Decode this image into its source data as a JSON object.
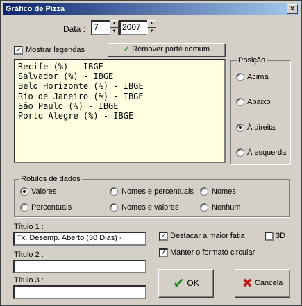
{
  "window": {
    "title": "Gráfico de Pizza",
    "close_glyph": "x"
  },
  "date": {
    "label": "Data :",
    "month": "7",
    "year": "2007"
  },
  "show_legends": {
    "label": "Mostrar legendas",
    "checked": true
  },
  "remove_common": {
    "label": "Remover parte comum"
  },
  "legend_items": [
    "Recife (%) - IBGE",
    "Salvador (%) - IBGE",
    "Belo Horizonte (%) - IBGE",
    "Rio de Janeiro (%) - IBGE",
    "São Paulo (%) - IBGE",
    "Porto Alegre (%) - IBGE"
  ],
  "position": {
    "title": "Posição",
    "options": [
      "Acima",
      "Abaixo",
      "À direita",
      "À esquerda"
    ],
    "selected": "À direita"
  },
  "data_labels": {
    "title": "Rótulos de dados",
    "options": [
      "Valores",
      "Nomes e percentuais",
      "Nomes",
      "Percentuais",
      "Nomes e valores",
      "Nenhum"
    ],
    "selected": "Valores"
  },
  "titles": {
    "title1_label": "Título 1 :",
    "title1_value": "Tx. Desemp. Aberto (30 Dias) -",
    "title2_label": "Título 2 :",
    "title2_value": "",
    "title3_label": "Título 3 :",
    "title3_value": ""
  },
  "options": {
    "highlight_label": "Destacar a maior fatia",
    "highlight_checked": true,
    "threed_label": "3D",
    "threed_checked": false,
    "circular_label": "Manter o formato circular",
    "circular_checked": true
  },
  "buttons": {
    "ok": "OK",
    "cancel": "Cancela"
  },
  "colors": {
    "ok_check": "#1a8a1a",
    "cancel_x": "#c01818",
    "remove_check": "#1a8a1a"
  }
}
